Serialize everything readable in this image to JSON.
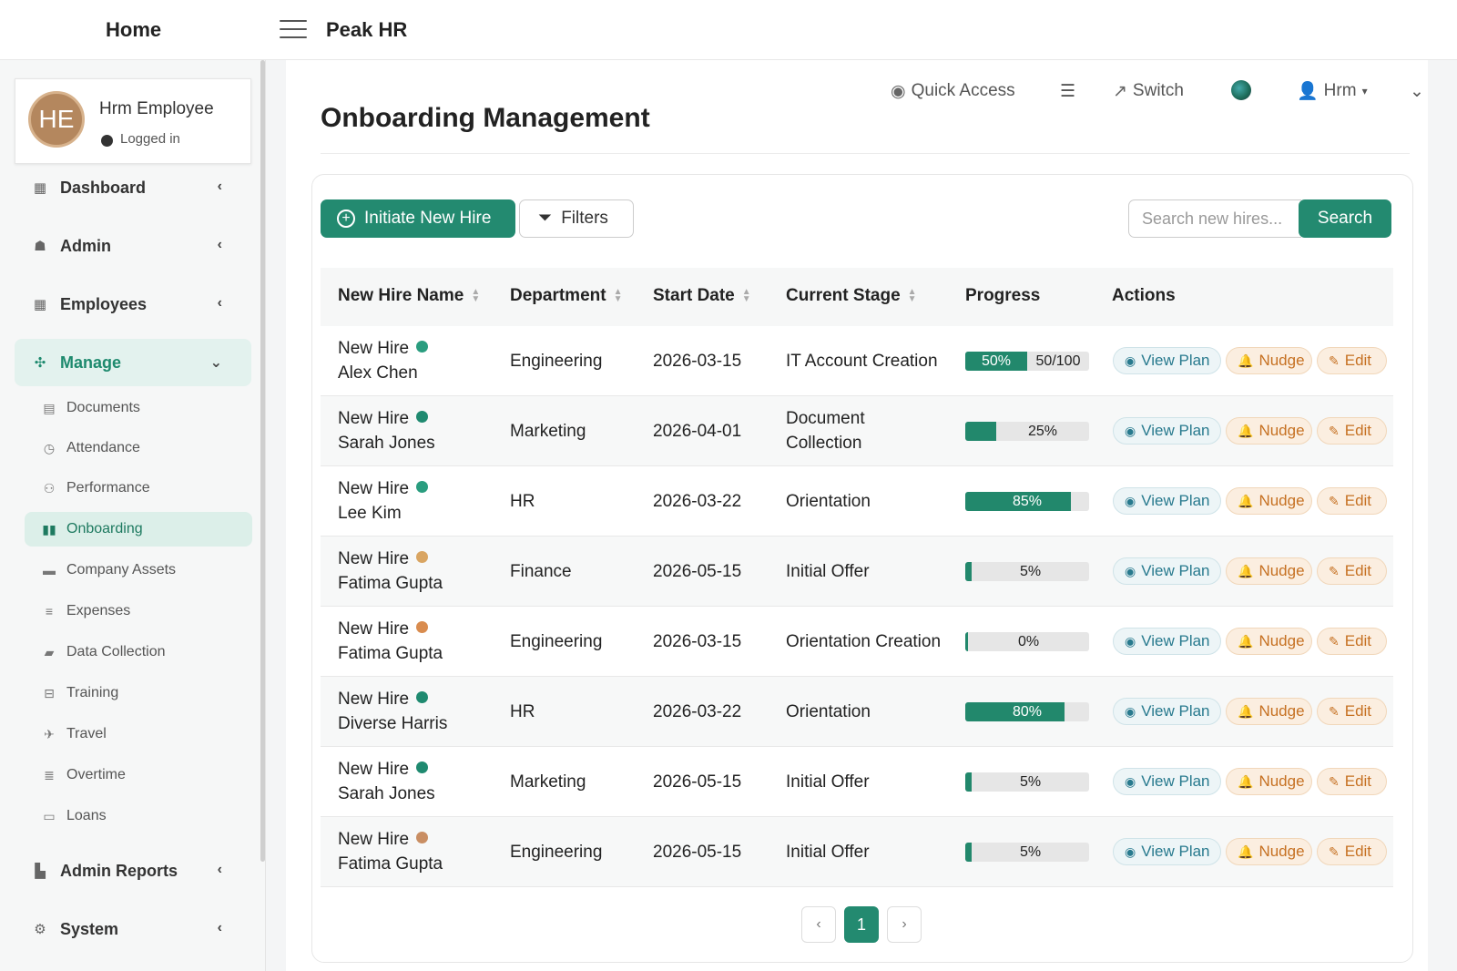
{
  "topbar": {
    "home": "Home",
    "app_title": "Peak HR"
  },
  "user": {
    "initials": "HE",
    "name": "Hrm Employee",
    "status": "Logged in"
  },
  "sidebar": {
    "items": [
      {
        "label": "Dashboard",
        "icon": "grid-icon"
      },
      {
        "label": "Admin",
        "icon": "users-cog-icon"
      },
      {
        "label": "Employees",
        "icon": "table-icon"
      },
      {
        "label": "Manage",
        "icon": "manage-icon"
      }
    ],
    "sub_items": [
      {
        "label": "Documents",
        "icon": "file-icon"
      },
      {
        "label": "Attendance",
        "icon": "clock-icon"
      },
      {
        "label": "Performance",
        "icon": "performance-icon"
      },
      {
        "label": "Onboarding",
        "icon": "columns-icon"
      },
      {
        "label": "Company Assets",
        "icon": "box-icon"
      },
      {
        "label": "Expenses",
        "icon": "list-icon"
      },
      {
        "label": "Data Collection",
        "icon": "folder-icon"
      },
      {
        "label": "Training",
        "icon": "briefcase-icon"
      },
      {
        "label": "Travel",
        "icon": "plane-icon"
      },
      {
        "label": "Overtime",
        "icon": "align-icon"
      },
      {
        "label": "Loans",
        "icon": "money-icon"
      }
    ],
    "bottom_items": [
      {
        "label": "Admin Reports",
        "icon": "report-icon"
      },
      {
        "label": "System",
        "icon": "cogs-icon"
      }
    ]
  },
  "toolbar": {
    "quick_access": "Quick Access",
    "switch": "Switch",
    "user_menu": "Hrm"
  },
  "page": {
    "title": "Onboarding Management"
  },
  "actions": {
    "initiate": "Initiate New Hire",
    "filters": "Filters",
    "search_placeholder": "Search new hires...",
    "search_button": "Search"
  },
  "table": {
    "columns": [
      "New Hire Name",
      "Department",
      "Start Date",
      "Current Stage",
      "Progress",
      "Actions"
    ],
    "row_actions": {
      "view": "View Plan",
      "nudge": "Nudge",
      "edit": "Edit"
    },
    "rows": [
      {
        "name_line1": "New Hire",
        "name_line2": "Alex Chen",
        "dot": "#2a9d7f",
        "department": "Engineering",
        "start_date": "2026-03-15",
        "stage_line1": "IT Account Creation",
        "stage_line2": "",
        "progress": 0.5,
        "progress_label": "50%",
        "progress_extra": "50/100"
      },
      {
        "name_line1": "New Hire",
        "name_line2": "Sarah Jones",
        "dot": "#1f8a70",
        "department": "Marketing",
        "start_date": "2026-04-01",
        "stage_line1": "Document",
        "stage_line2": "Collection",
        "progress": 0.25,
        "progress_label": "25%",
        "progress_extra": ""
      },
      {
        "name_line1": "New Hire",
        "name_line2": "Lee Kim",
        "dot": "#2a9d7f",
        "department": "HR",
        "start_date": "2026-03-22",
        "stage_line1": "Orientation",
        "stage_line2": "",
        "progress": 0.85,
        "progress_label": "85%",
        "progress_extra": ""
      },
      {
        "name_line1": "New Hire",
        "name_line2": "Fatima Gupta",
        "dot": "#d9a562",
        "department": "Finance",
        "start_date": "2026-05-15",
        "stage_line1": "Initial Offer",
        "stage_line2": "",
        "progress": 0.05,
        "progress_label": "5%",
        "progress_extra": ""
      },
      {
        "name_line1": "New Hire",
        "name_line2": "Fatima Gupta",
        "dot": "#d98c4f",
        "department": "Engineering",
        "start_date": "2026-03-15",
        "stage_line1": "Orientation Creation",
        "stage_line2": "",
        "progress": 0.0,
        "progress_label": "0%",
        "progress_extra": ""
      },
      {
        "name_line1": "New Hire",
        "name_line2": "Diverse Harris",
        "dot": "#1f8a70",
        "department": "HR",
        "start_date": "2026-03-22",
        "stage_line1": "Orientation",
        "stage_line2": "",
        "progress": 0.8,
        "progress_label": "80%",
        "progress_extra": ""
      },
      {
        "name_line1": "New Hire",
        "name_line2": "Sarah Jones",
        "dot": "#1f8a70",
        "department": "Marketing",
        "start_date": "2026-05-15",
        "stage_line1": "Initial Offer",
        "stage_line2": "",
        "progress": 0.05,
        "progress_label": "5%",
        "progress_extra": ""
      },
      {
        "name_line1": "New Hire",
        "name_line2": "Fatima Gupta",
        "dot": "#c98e63",
        "department": "Engineering",
        "start_date": "2026-05-15",
        "stage_line1": "Initial Offer",
        "stage_line2": "",
        "progress": 0.05,
        "progress_label": "5%",
        "progress_extra": ""
      }
    ]
  },
  "pagination": {
    "current": "1",
    "prev": "‹",
    "next": "›"
  },
  "colors": {
    "accent": "#238a70",
    "nudge": "#c67122",
    "view": "#287a8e"
  }
}
